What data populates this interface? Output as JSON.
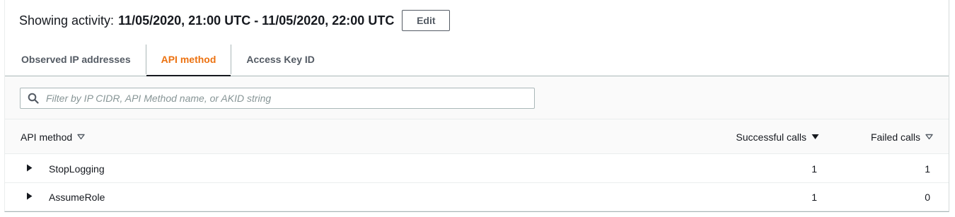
{
  "header": {
    "prefix": "Showing activity:",
    "range": "11/05/2020, 21:00 UTC - 11/05/2020, 22:00 UTC",
    "edit_label": "Edit"
  },
  "tabs": [
    {
      "label": "Observed IP addresses",
      "active": false
    },
    {
      "label": "API method",
      "active": true
    },
    {
      "label": "Access Key ID",
      "active": false
    }
  ],
  "search": {
    "placeholder": "Filter by IP CIDR, API Method name, or AKID string",
    "value": ""
  },
  "table": {
    "columns": [
      {
        "label": "API method",
        "sort": "unsorted"
      },
      {
        "label": "Successful calls",
        "sort": "descending"
      },
      {
        "label": "Failed calls",
        "sort": "unsorted"
      }
    ],
    "rows": [
      {
        "method": "StopLogging",
        "successful": "1",
        "failed": "1"
      },
      {
        "method": "AssumeRole",
        "successful": "1",
        "failed": "0"
      }
    ]
  },
  "colors": {
    "accent": "#ec7211",
    "text": "#16191f",
    "muted": "#545b64",
    "border": "#aab7b8"
  },
  "icons": {
    "search": "search-icon",
    "expand": "caret-right-icon",
    "sort_unsorted": "sort-triangle-outline-icon",
    "sort_desc": "sort-triangle-filled-icon"
  }
}
